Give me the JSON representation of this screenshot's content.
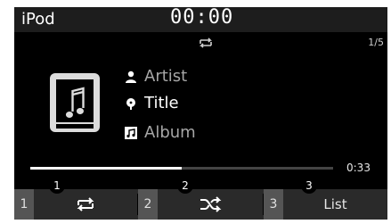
{
  "header": {
    "app_title": "iPod",
    "clock": "00:00"
  },
  "status": {
    "repeat_icon": "repeat-icon",
    "track_counter": "1/5"
  },
  "now_playing": {
    "artist": "Artist",
    "title": "Title",
    "album": "Album",
    "artist_icon": "person-icon",
    "title_icon": "music-note-icon",
    "album_icon": "album-icon",
    "art_icon": "music-file-icon",
    "progress_fraction": 0.5,
    "elapsed": "0:33"
  },
  "softkeys": [
    {
      "number": "1",
      "icon": "repeat-icon",
      "callout": "1"
    },
    {
      "number": "2",
      "icon": "shuffle-icon",
      "callout": "2"
    },
    {
      "number": "3",
      "label": "List",
      "callout": "3"
    }
  ],
  "colors": {
    "background": "#000000",
    "bar": "#2a2a2a",
    "badge": "#555555",
    "text_dim": "#a6a6a6"
  }
}
